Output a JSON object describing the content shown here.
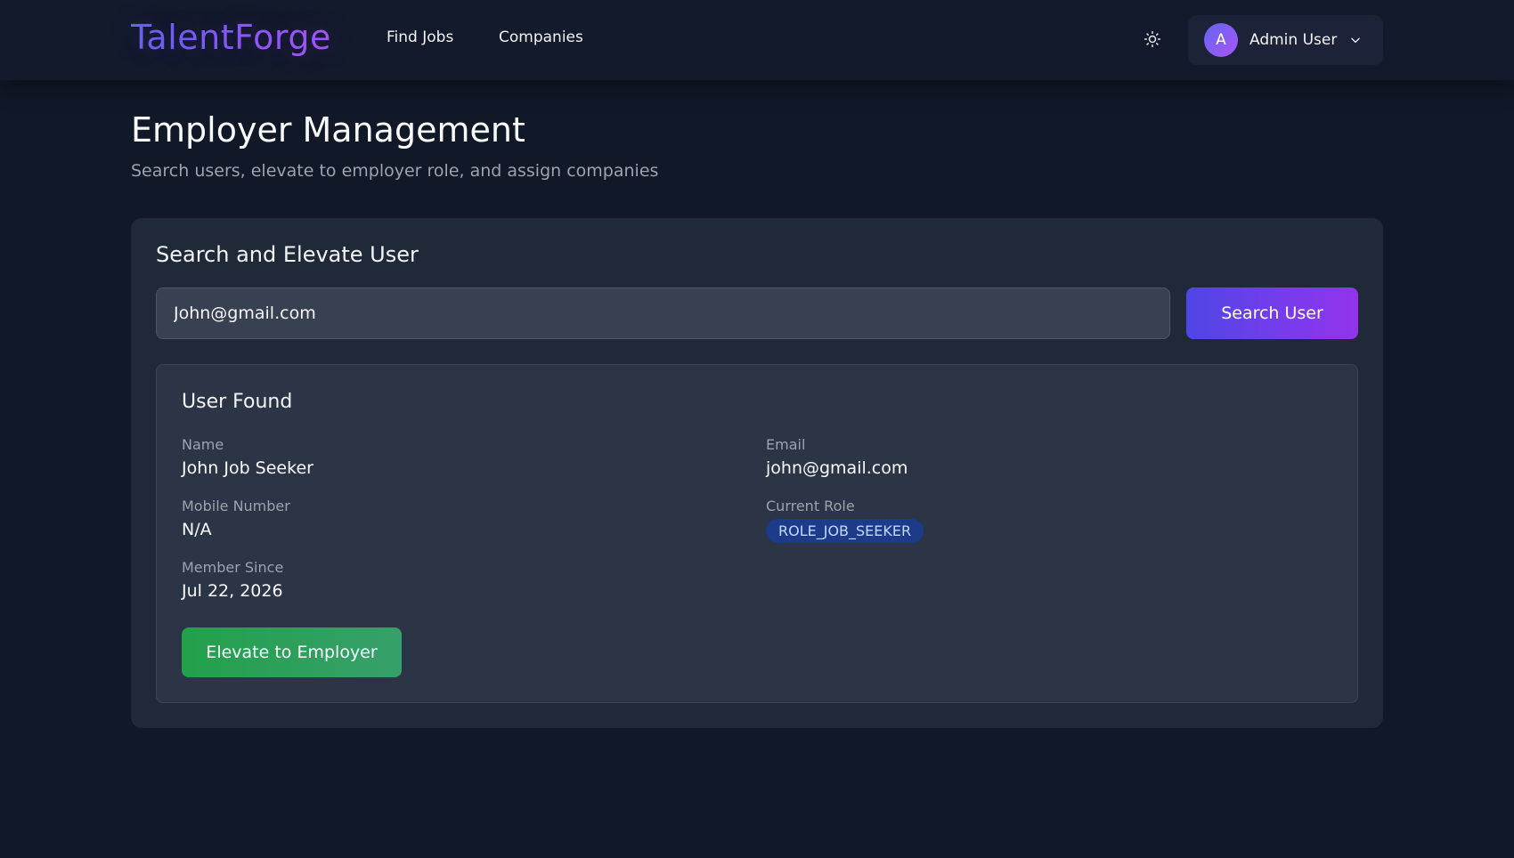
{
  "nav": {
    "logo": "TalentForge",
    "links": [
      "Find Jobs",
      "Companies"
    ],
    "theme_icon": "sun-icon",
    "user": {
      "avatar_initial": "A",
      "name": "Admin User",
      "menu_icon": "chevron-down-icon"
    }
  },
  "page": {
    "title": "Employer Management",
    "subtitle": "Search users, elevate to employer role, and assign companies"
  },
  "search": {
    "heading": "Search and Elevate User",
    "input_value": "John@gmail.com",
    "button_label": "Search User"
  },
  "result": {
    "heading": "User Found",
    "fields": {
      "name": {
        "label": "Name",
        "value": "John Job Seeker"
      },
      "email": {
        "label": "Email",
        "value": "john@gmail.com"
      },
      "mobile": {
        "label": "Mobile Number",
        "value": "N/A"
      },
      "role": {
        "label": "Current Role",
        "value": "ROLE_JOB_SEEKER"
      },
      "since": {
        "label": "Member Since",
        "value": "Jul 22, 2026"
      }
    },
    "elevate_label": "Elevate to Employer"
  },
  "colors": {
    "background": "#111827",
    "card": "#1f2937",
    "accent_start": "#4f46e5",
    "accent_end": "#9333ea",
    "success": "#22a04b",
    "role_badge": "#1e3a8a"
  }
}
